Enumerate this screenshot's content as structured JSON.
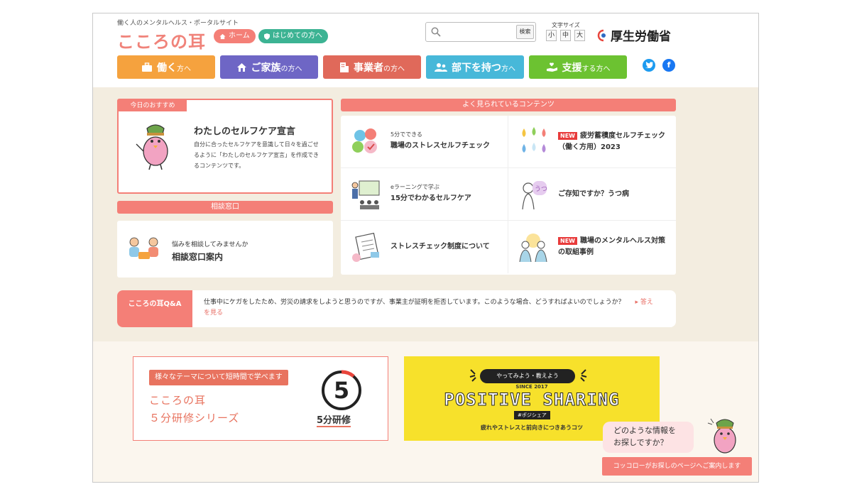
{
  "header": {
    "tagline": "働く人のメンタルヘルス・ポータルサイト",
    "logo": "こころの耳",
    "home_label": "ホーム",
    "first_label": "はじめての方へ",
    "search_button": "検索",
    "search_placeholder": "",
    "font_size_label": "文字サイズ",
    "font_sizes": [
      "小",
      "中",
      "大"
    ],
    "ministry": "厚生労働省"
  },
  "categories": [
    {
      "big": "働く",
      "small": "方へ",
      "color": "#f5a23e"
    },
    {
      "big": "ご家族",
      "small": "の方へ",
      "color": "#6e66c5"
    },
    {
      "big": "事業者",
      "small": "の方へ",
      "color": "#e0695a"
    },
    {
      "big": "部下を持つ",
      "small": "方へ",
      "color": "#47b8d9"
    },
    {
      "big": "支援",
      "small": "する方へ",
      "color": "#6cc231"
    }
  ],
  "recommend": {
    "tab": "今日のおすすめ",
    "title": "わたしのセルフケア宣言",
    "description": "自分に合ったセルフケアを意識して日々を過ごせるように「わたしのセルフケア宣言」を作成できるコンテンツです。"
  },
  "consult": {
    "head": "相談窓口",
    "sub": "悩みを相談してみませんか",
    "title": "相談窓口案内"
  },
  "popular": {
    "head": "よく見られているコンテンツ",
    "new_badge": "NEW",
    "items": [
      {
        "sub": "5分でできる",
        "title": "職場のストレスセルフチェック",
        "new": false
      },
      {
        "sub": "",
        "title": "疲労蓄積度セルフチェック（働く方用）2023",
        "new": true
      },
      {
        "sub": "eラーニングで学ぶ",
        "title": "15分でわかるセルフケア",
        "new": false
      },
      {
        "sub": "",
        "title": "ご存知ですか？うつ病",
        "new": false
      },
      {
        "sub": "",
        "title": "ストレスチェック制度について",
        "new": false
      },
      {
        "sub": "",
        "title": "職場のメンタルヘルス対策の取組事例",
        "new": true
      }
    ]
  },
  "qa": {
    "tab": "こころの耳Q&A",
    "question": "仕事中にケガをしたため、労災の請求をしようと思うのですが、事業主が証明を拒否しています。このような場合、どうすればよいのでしょうか？",
    "link": "答えを見る"
  },
  "series": {
    "badge": "様々なテーマについて短時間で学べます",
    "line1": "こころの耳",
    "line2": "５分研修シリーズ",
    "number": "5",
    "label": "5分研修"
  },
  "positive": {
    "pill": "やってみよう・教えよう",
    "since": "SINCE 2017",
    "title": "POSITIVE SHARING",
    "tag": "#ポジシェア",
    "caption": "疲れやストレスと前向きにつきあうコツ"
  },
  "assistant": {
    "bubble_line1": "どのような情報を",
    "bubble_line2": "お探しですか？",
    "button": "コッコローがお探しのページへご案内します"
  }
}
